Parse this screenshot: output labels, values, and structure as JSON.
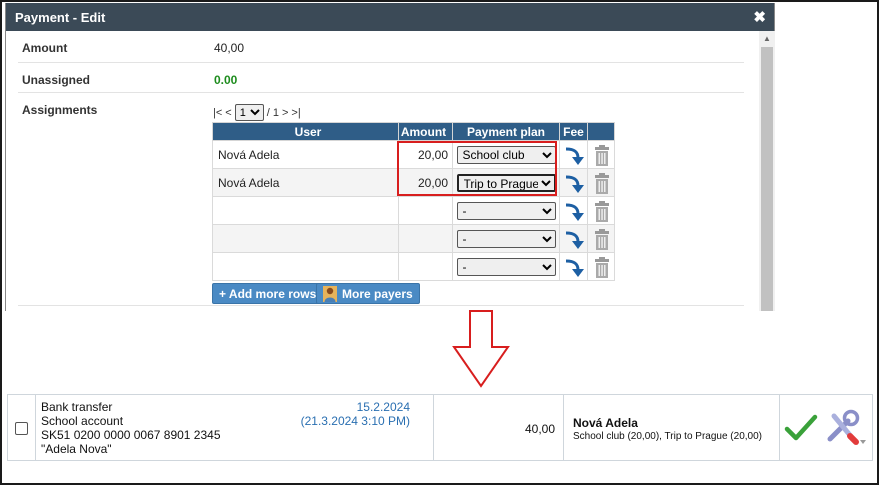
{
  "dialog": {
    "title": "Payment - Edit",
    "close_symbol": "✖",
    "amount_label": "Amount",
    "amount_value": "40,00",
    "unassigned_label": "Unassigned",
    "unassigned_value": "0.00",
    "assignments_label": "Assignments",
    "pager": {
      "first": "|<",
      "prev": "<",
      "page": "1",
      "of": "/ 1",
      "next": ">",
      "last": ">|"
    },
    "table": {
      "headers": [
        "User",
        "Amount",
        "Payment plan",
        "Fee"
      ],
      "rows": [
        {
          "user": "Nová Adela",
          "amount": "20,00",
          "plan": "School club"
        },
        {
          "user": "Nová Adela",
          "amount": "20,00",
          "plan": "Trip to Prague"
        },
        {
          "user": "",
          "amount": "",
          "plan": "-"
        },
        {
          "user": "",
          "amount": "",
          "plan": "-"
        },
        {
          "user": "",
          "amount": "",
          "plan": "-"
        }
      ]
    },
    "add_rows_label": "+ Add more rows",
    "more_payers_label": "More payers"
  },
  "transaction": {
    "method": "Bank transfer",
    "account_name": "School account",
    "iban": "SK51 0200 0000 0067 8901 2345",
    "payer": "\"Adela Nova\"",
    "date": "15.2.2024",
    "datetime": "(21.3.2024 3:10 PM)",
    "amount": "40,00",
    "user": "Nová Adela",
    "assignments": "School club (20,00), Trip to Prague (20,00)"
  },
  "colors": {
    "header_bg": "#3b4a57",
    "table_header_bg": "#2f5d87",
    "highlight": "#d81e1e",
    "button_bg": "#4a8ac4",
    "link_blue": "#2a6fb1",
    "unassigned_green": "#1e8c1e"
  },
  "icons": {
    "fee": "curved-arrow-right-icon",
    "delete": "trash-icon",
    "approve": "check-icon",
    "tools": "tools-icon",
    "more_payers": "person-icon",
    "arrow": "down-arrow-icon"
  }
}
